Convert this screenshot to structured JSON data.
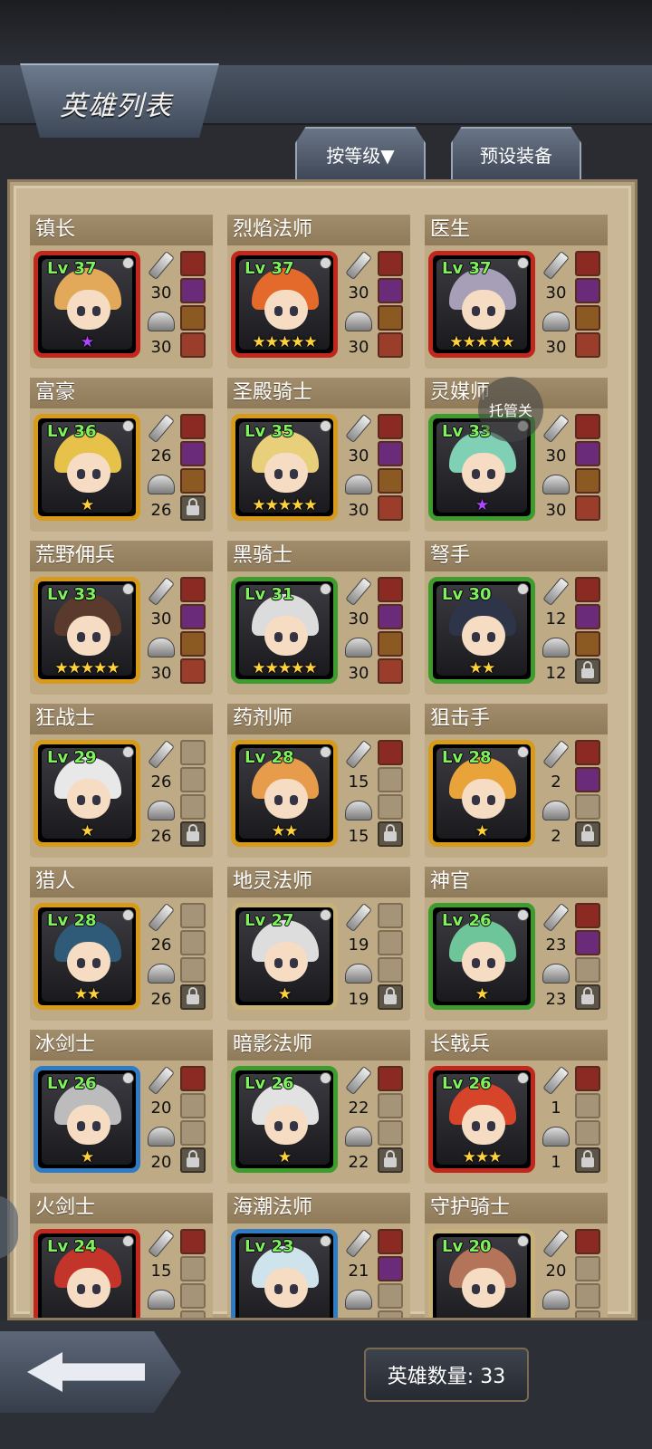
{
  "header": {
    "title": "英雄列表"
  },
  "toolbar": {
    "sort_label": "按等级▼",
    "preset_label": "预设装备"
  },
  "auto_button": {
    "label": "托管关"
  },
  "footer": {
    "hero_count": "英雄数量: 33"
  },
  "heroes": [
    {
      "name": "镇长",
      "level": "Lv 37",
      "frame": "#c1271c",
      "stars": "★",
      "star_color": "#b046ff",
      "atk": "30",
      "def": "30",
      "slots": [
        "filled",
        "filled",
        "filled",
        "filled"
      ]
    },
    {
      "name": "烈焰法师",
      "level": "Lv 37",
      "frame": "#c1271c",
      "stars": "★★★★★",
      "star_color": "#ffd23a",
      "atk": "30",
      "def": "30",
      "slots": [
        "filled",
        "filled",
        "filled",
        "filled"
      ]
    },
    {
      "name": "医生",
      "level": "Lv 37",
      "frame": "#c1271c",
      "stars": "★★★★★",
      "star_color": "#ffd23a",
      "atk": "30",
      "def": "30",
      "slots": [
        "filled",
        "filled",
        "filled",
        "filled"
      ]
    },
    {
      "name": "富豪",
      "level": "Lv 36",
      "frame": "#d79a1a",
      "stars": "★",
      "star_color": "#ffd23a",
      "atk": "26",
      "def": "26",
      "slots": [
        "filled",
        "filled",
        "filled",
        "locked"
      ]
    },
    {
      "name": "圣殿骑士",
      "level": "Lv 35",
      "frame": "#d79a1a",
      "stars": "★★★★★",
      "star_color": "#ffd23a",
      "atk": "30",
      "def": "30",
      "slots": [
        "filled",
        "filled",
        "filled",
        "filled"
      ]
    },
    {
      "name": "灵媒师",
      "level": "Lv 33",
      "frame": "#3e9b2e",
      "stars": "★",
      "star_color": "#b046ff",
      "atk": "30",
      "def": "30",
      "slots": [
        "filled",
        "filled",
        "filled",
        "filled"
      ]
    },
    {
      "name": "荒野佣兵",
      "level": "Lv 33",
      "frame": "#d79a1a",
      "stars": "★★★★★",
      "star_color": "#ffd23a",
      "atk": "30",
      "def": "30",
      "slots": [
        "filled",
        "filled",
        "filled",
        "filled"
      ]
    },
    {
      "name": "黑骑士",
      "level": "Lv 31",
      "frame": "#3e9b2e",
      "stars": "★★★★★",
      "star_color": "#ffd23a",
      "atk": "30",
      "def": "30",
      "slots": [
        "filled",
        "filled",
        "filled",
        "filled"
      ]
    },
    {
      "name": "弩手",
      "level": "Lv 30",
      "frame": "#3e9b2e",
      "stars": "★★",
      "star_color": "#ffd23a",
      "atk": "12",
      "def": "12",
      "slots": [
        "filled",
        "filled",
        "filled",
        "locked"
      ]
    },
    {
      "name": "狂战士",
      "level": "Lv 29",
      "frame": "#d79a1a",
      "stars": "★",
      "star_color": "#ffd23a",
      "atk": "26",
      "def": "26",
      "slots": [
        "empty",
        "empty",
        "empty",
        "locked"
      ]
    },
    {
      "name": "药剂师",
      "level": "Lv 28",
      "frame": "#d79a1a",
      "stars": "★★",
      "star_color": "#ffd23a",
      "atk": "15",
      "def": "15",
      "slots": [
        "filled",
        "empty",
        "empty",
        "locked"
      ]
    },
    {
      "name": "狙击手",
      "level": "Lv 28",
      "frame": "#d79a1a",
      "stars": "★",
      "star_color": "#ffd23a",
      "atk": "2",
      "def": "2",
      "slots": [
        "filled",
        "filled",
        "empty",
        "locked"
      ]
    },
    {
      "name": "猎人",
      "level": "Lv 28",
      "frame": "#d79a1a",
      "stars": "★★",
      "star_color": "#ffd23a",
      "atk": "26",
      "def": "26",
      "slots": [
        "empty",
        "empty",
        "empty",
        "locked"
      ]
    },
    {
      "name": "地灵法师",
      "level": "Lv 27",
      "frame": "#c8b27a",
      "stars": "★",
      "star_color": "#ffd23a",
      "atk": "19",
      "def": "19",
      "slots": [
        "empty",
        "empty",
        "empty",
        "locked"
      ]
    },
    {
      "name": "神官",
      "level": "Lv 26",
      "frame": "#3e9b2e",
      "stars": "★",
      "star_color": "#ffd23a",
      "atk": "23",
      "def": "23",
      "slots": [
        "filled",
        "filled",
        "empty",
        "locked"
      ]
    },
    {
      "name": "冰剑士",
      "level": "Lv 26",
      "frame": "#2f7cc4",
      "stars": "★",
      "star_color": "#ffd23a",
      "atk": "20",
      "def": "20",
      "slots": [
        "filled",
        "empty",
        "empty",
        "locked"
      ]
    },
    {
      "name": "暗影法师",
      "level": "Lv 26",
      "frame": "#3e9b2e",
      "stars": "★",
      "star_color": "#ffd23a",
      "atk": "22",
      "def": "22",
      "slots": [
        "filled",
        "empty",
        "empty",
        "locked"
      ]
    },
    {
      "name": "长戟兵",
      "level": "Lv 26",
      "frame": "#c1271c",
      "stars": "★★★",
      "star_color": "#ffd23a",
      "atk": "1",
      "def": "1",
      "slots": [
        "filled",
        "empty",
        "empty",
        "locked"
      ]
    },
    {
      "name": "火剑士",
      "level": "Lv 24",
      "frame": "#c1271c",
      "stars": "",
      "star_color": "#ffd23a",
      "atk": "15",
      "def": "",
      "slots": [
        "filled",
        "empty",
        "empty",
        "empty"
      ]
    },
    {
      "name": "海潮法师",
      "level": "Lv 23",
      "frame": "#2f7cc4",
      "stars": "",
      "star_color": "#ffd23a",
      "atk": "21",
      "def": "",
      "slots": [
        "filled",
        "filled",
        "empty",
        "empty"
      ]
    },
    {
      "name": "守护骑士",
      "level": "Lv 20",
      "frame": "#c8b27a",
      "stars": "",
      "star_color": "#ffd23a",
      "atk": "20",
      "def": "",
      "slots": [
        "filled",
        "empty",
        "empty",
        "empty"
      ]
    }
  ]
}
